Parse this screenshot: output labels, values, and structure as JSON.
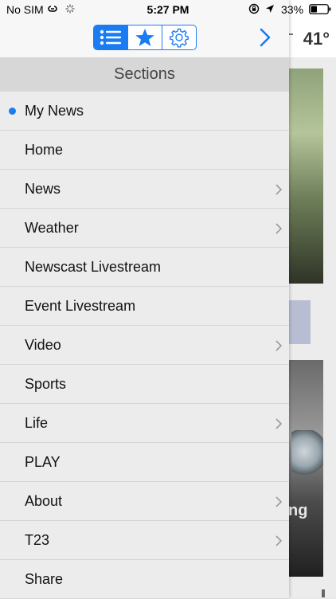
{
  "status_bar": {
    "carrier": "No SIM",
    "time": "5:27 PM",
    "battery_percent": "33%",
    "icons": [
      "link-icon",
      "activity-spinner-icon",
      "orientation-lock-icon",
      "location-arrow-icon",
      "battery-icon"
    ]
  },
  "background_app": {
    "temperature": "41°",
    "partial_caption": "ng"
  },
  "toolbar": {
    "segments": [
      {
        "icon": "list-icon",
        "active": true
      },
      {
        "icon": "star-icon",
        "active": false
      },
      {
        "icon": "gear-icon",
        "active": false
      }
    ],
    "forward_icon": "chevron-right-icon"
  },
  "drawer": {
    "title": "Sections",
    "accent_color": "#1a7cf3",
    "items": [
      {
        "label": "My News",
        "selected": true,
        "has_submenu": false
      },
      {
        "label": "Home",
        "selected": false,
        "has_submenu": false
      },
      {
        "label": "News",
        "selected": false,
        "has_submenu": true
      },
      {
        "label": "Weather",
        "selected": false,
        "has_submenu": true
      },
      {
        "label": "Newscast Livestream",
        "selected": false,
        "has_submenu": false
      },
      {
        "label": "Event Livestream",
        "selected": false,
        "has_submenu": false
      },
      {
        "label": "Video",
        "selected": false,
        "has_submenu": true
      },
      {
        "label": "Sports",
        "selected": false,
        "has_submenu": false
      },
      {
        "label": "Life",
        "selected": false,
        "has_submenu": true
      },
      {
        "label": "PLAY",
        "selected": false,
        "has_submenu": false
      },
      {
        "label": "About",
        "selected": false,
        "has_submenu": true
      },
      {
        "label": "T23",
        "selected": false,
        "has_submenu": true
      },
      {
        "label": "Share",
        "selected": false,
        "has_submenu": false
      }
    ]
  }
}
